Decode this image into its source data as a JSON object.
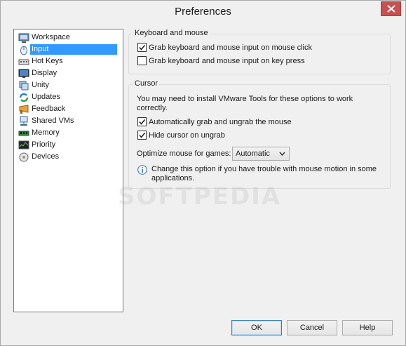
{
  "window": {
    "title": "Preferences"
  },
  "nav": {
    "items": [
      {
        "label": "Workspace",
        "icon": "workspace-icon"
      },
      {
        "label": "Input",
        "icon": "mouse-icon",
        "selected": true
      },
      {
        "label": "Hot Keys",
        "icon": "keyboard-icon"
      },
      {
        "label": "Display",
        "icon": "monitor-icon"
      },
      {
        "label": "Unity",
        "icon": "unity-icon"
      },
      {
        "label": "Updates",
        "icon": "updates-icon"
      },
      {
        "label": "Feedback",
        "icon": "feedback-icon"
      },
      {
        "label": "Shared VMs",
        "icon": "shared-vms-icon"
      },
      {
        "label": "Memory",
        "icon": "memory-icon"
      },
      {
        "label": "Priority",
        "icon": "priority-icon"
      },
      {
        "label": "Devices",
        "icon": "devices-icon"
      }
    ]
  },
  "keyboard_mouse": {
    "title": "Keyboard and mouse",
    "grab_on_click": {
      "label": "Grab keyboard and mouse input on mouse click",
      "checked": true
    },
    "grab_on_keypress": {
      "label": "Grab keyboard and mouse input on key press",
      "checked": false
    }
  },
  "cursor": {
    "title": "Cursor",
    "note_line1": "You may need to install VMware Tools for these options to work",
    "note_line2": "correctly.",
    "auto_grab": {
      "label": "Automatically grab and ungrab the mouse",
      "checked": true
    },
    "hide_cursor": {
      "label": "Hide cursor on ungrab",
      "checked": true
    },
    "optimize_label": "Optimize mouse for games:",
    "optimize_value": "Automatic",
    "info_line1": "Change this option if you have trouble with mouse motion in some",
    "info_line2": "applications."
  },
  "buttons": {
    "ok": "OK",
    "cancel": "Cancel",
    "help": "Help"
  },
  "watermark": "SOFTPEDIA",
  "colors": {
    "selection": "#3399ff",
    "close_button": "#c75050"
  }
}
